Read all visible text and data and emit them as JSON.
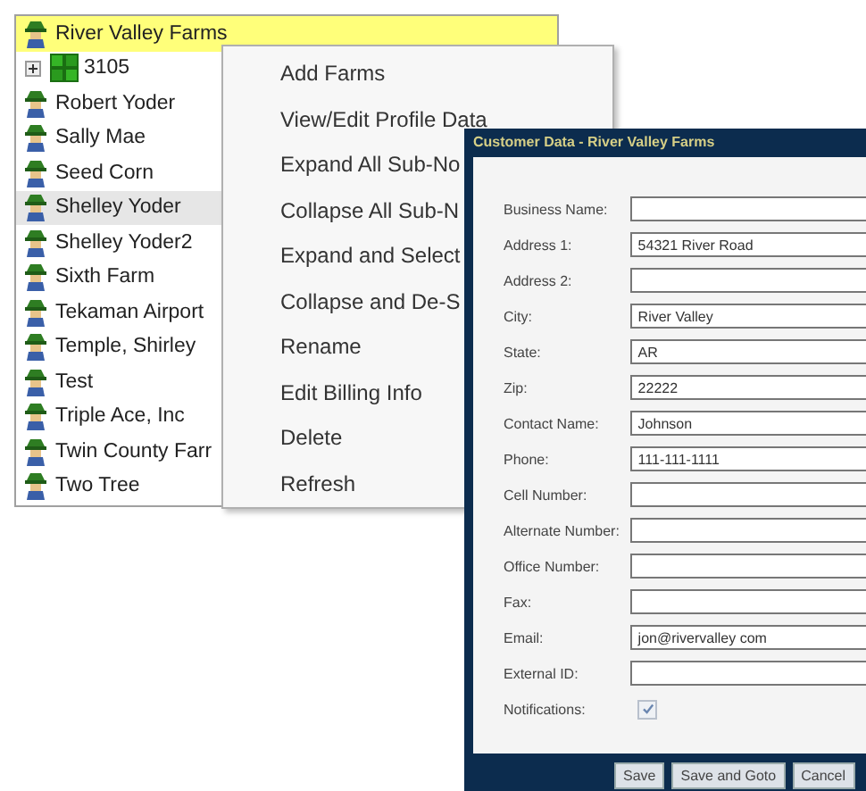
{
  "tree": {
    "items": [
      {
        "kind": "farm",
        "label": "River Valley Farms",
        "selected": true,
        "highlighted": false
      },
      {
        "kind": "field",
        "label": "3105",
        "selected": false,
        "highlighted": false,
        "expanded": false
      },
      {
        "kind": "farm",
        "label": "Robert Yoder",
        "selected": false,
        "highlighted": false
      },
      {
        "kind": "farm",
        "label": "Sally Mae",
        "selected": false,
        "highlighted": false
      },
      {
        "kind": "farm",
        "label": "Seed Corn",
        "selected": false,
        "highlighted": false
      },
      {
        "kind": "farm",
        "label": "Shelley Yoder",
        "selected": false,
        "highlighted": true
      },
      {
        "kind": "farm",
        "label": "Shelley Yoder2",
        "selected": false,
        "highlighted": false
      },
      {
        "kind": "farm",
        "label": "Sixth Farm",
        "selected": false,
        "highlighted": false
      },
      {
        "kind": "farm",
        "label": "Tekaman Airport",
        "selected": false,
        "highlighted": false
      },
      {
        "kind": "farm",
        "label": "Temple, Shirley",
        "selected": false,
        "highlighted": false
      },
      {
        "kind": "farm",
        "label": "Test",
        "selected": false,
        "highlighted": false
      },
      {
        "kind": "farm",
        "label": "Triple Ace, Inc",
        "selected": false,
        "highlighted": false
      },
      {
        "kind": "farm",
        "label": "Twin County Farr",
        "selected": false,
        "highlighted": false
      },
      {
        "kind": "farm",
        "label": "Two Tree",
        "selected": false,
        "highlighted": false
      }
    ]
  },
  "context_menu": {
    "items": [
      "Add Farms",
      "View/Edit Profile Data",
      "Expand All Sub-No",
      "Collapse All Sub-N",
      "Expand and Select",
      "Collapse and De-S",
      "Rename",
      "Edit Billing Info",
      "Delete",
      "Refresh"
    ]
  },
  "dialog": {
    "title": "Customer Data - River Valley Farms",
    "fields": [
      {
        "kind": "text",
        "label": "Business Name:"
      },
      {
        "kind": "text",
        "label": "Address 1:",
        "value": "54321 River Road"
      },
      {
        "kind": "text",
        "label": "Address 2:"
      },
      {
        "kind": "text",
        "label": "City:",
        "value": "River Valley"
      },
      {
        "kind": "text",
        "label": "State:",
        "value": "AR"
      },
      {
        "kind": "text",
        "label": "Zip:",
        "value": "22222"
      },
      {
        "kind": "text",
        "label": "Contact Name:",
        "value": "Johnson"
      },
      {
        "kind": "text",
        "label": "Phone:",
        "value": "111-111-1111"
      },
      {
        "kind": "text",
        "label": "Cell Number:"
      },
      {
        "kind": "text",
        "label": "Alternate Number:"
      },
      {
        "kind": "text",
        "label": "Office Number:"
      },
      {
        "kind": "text",
        "label": "Fax:"
      },
      {
        "kind": "text",
        "label": "Email:",
        "value": "jon@rivervalley com"
      },
      {
        "kind": "text",
        "label": "External ID:"
      },
      {
        "kind": "checkbox",
        "label": "Notifications:",
        "checked": true
      }
    ],
    "buttons": [
      "Save",
      "Save and Goto",
      "Cancel"
    ]
  }
}
